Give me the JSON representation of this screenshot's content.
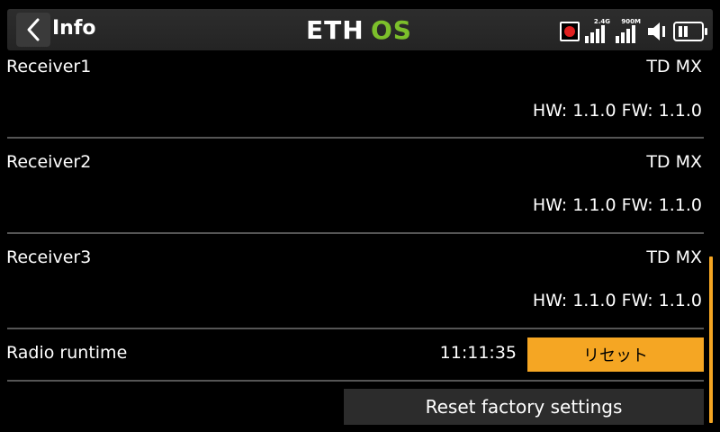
{
  "header": {
    "title": "Info",
    "logo_text_left": "ETH",
    "logo_text_right": "OS",
    "signal_24_label": "2.4G",
    "signal_900_label": "900M",
    "accent_color": "#f5a623",
    "logo_green": "#7cc02b"
  },
  "receivers": [
    {
      "label": "Receiver1",
      "model": "TD MX",
      "version": "HW: 1.1.0 FW: 1.1.0"
    },
    {
      "label": "Receiver2",
      "model": "TD MX",
      "version": "HW: 1.1.0 FW: 1.1.0"
    },
    {
      "label": "Receiver3",
      "model": "TD MX",
      "version": "HW: 1.1.0 FW: 1.1.0"
    }
  ],
  "runtime": {
    "label": "Radio runtime",
    "value": "11:11:35",
    "reset_label": "リセット"
  },
  "factory_reset_label": "Reset factory settings"
}
